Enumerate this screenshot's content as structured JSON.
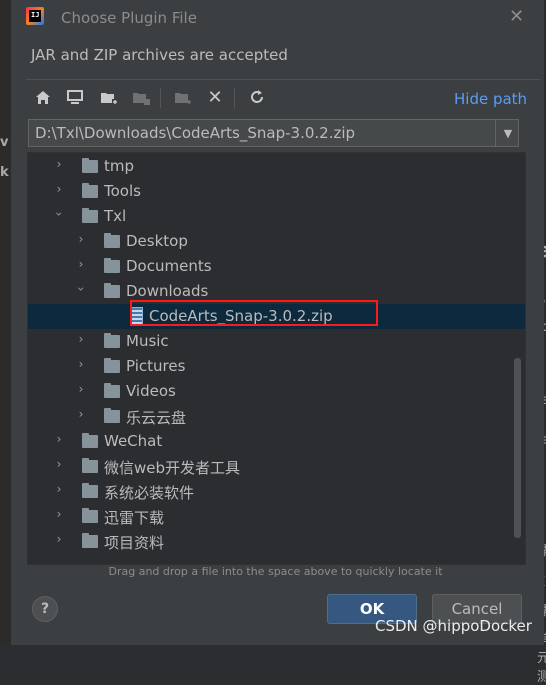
{
  "dialog": {
    "title": "Choose Plugin File",
    "description": "JAR and ZIP archives are accepted",
    "hide_path_label": "Hide path",
    "path_value": "D:\\Txl\\Downloads\\CodeArts_Snap-3.0.2.zip",
    "drag_hint": "Drag and drop a file into the space above to quickly locate it",
    "help_label": "?",
    "ok_label": "OK",
    "cancel_label": "Cancel"
  },
  "toolbar": {
    "icons": [
      "home-icon",
      "desktop-icon",
      "new-folder-icon",
      "project-folder-icon",
      "refresh-folder-icon",
      "delete-icon",
      "sync-icon"
    ]
  },
  "tree": {
    "rows": [
      {
        "label": "tmp",
        "expanded": false
      },
      {
        "label": "Tools",
        "expanded": false
      },
      {
        "label": "Txl",
        "expanded": true
      },
      {
        "label": "Desktop",
        "expanded": false
      },
      {
        "label": "Documents",
        "expanded": false
      },
      {
        "label": "Downloads",
        "expanded": true
      },
      {
        "label": "CodeArts_Snap-3.0.2.zip",
        "selected": true
      },
      {
        "label": "Music",
        "expanded": false
      },
      {
        "label": "Pictures",
        "expanded": false
      },
      {
        "label": "Videos",
        "expanded": false
      },
      {
        "label": "乐云云盘",
        "expanded": false
      },
      {
        "label": "WeChat",
        "expanded": false
      },
      {
        "label": "微信web开发者工具",
        "expanded": false
      },
      {
        "label": "系统必装软件",
        "expanded": false
      },
      {
        "label": "迅雷下载",
        "expanded": false
      },
      {
        "label": "项目资料",
        "expanded": false
      }
    ]
  },
  "background": {
    "left_letters": [
      "v",
      "k"
    ],
    "right_letters": [
      "e",
      "S",
      "fo",
      "ai",
      "le",
      "当",
      "鼎",
      "E",
      "鼎",
      "单元测"
    ]
  },
  "watermark": "CSDN @hippoDocker",
  "colors": {
    "accent_link": "#589df6",
    "selection": "#0d293e",
    "ok_button": "#365880",
    "highlight_box": "#ff1a1a"
  }
}
